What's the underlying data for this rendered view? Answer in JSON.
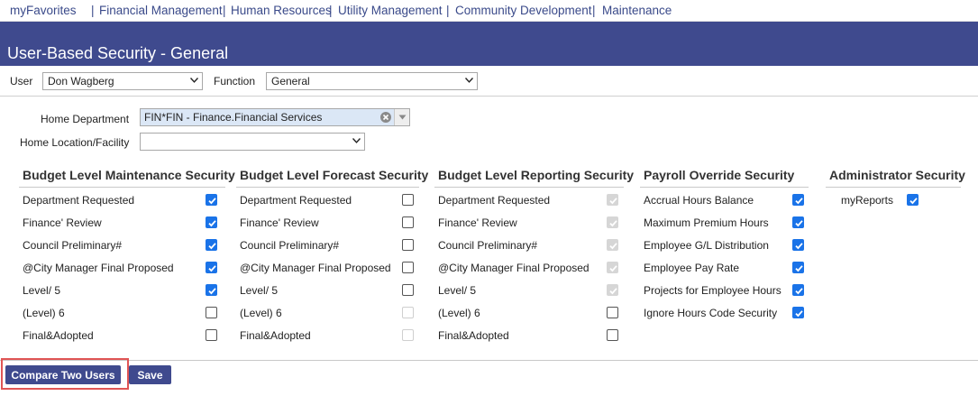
{
  "topnav": {
    "items": [
      "myFavorites",
      "Financial Management",
      "Human Resources",
      "Utility Management",
      "Community Development",
      "Maintenance"
    ]
  },
  "page": {
    "title": "User-Based Security - General"
  },
  "filters": {
    "user_label": "User",
    "user_value": "Don Wagberg",
    "function_label": "Function",
    "function_value": "General"
  },
  "home": {
    "dept_label": "Home Department",
    "dept_value": "FIN*FIN - Finance.Financial Services",
    "location_label": "Home Location/Facility",
    "location_value": ""
  },
  "sections": [
    {
      "title": "Budget Level Maintenance Security",
      "rows": [
        {
          "label": "Department Requested",
          "state": "on"
        },
        {
          "label": "Finance' Review",
          "state": "on"
        },
        {
          "label": "Council Preliminary#",
          "state": "on"
        },
        {
          "label": "@City Manager Final Proposed",
          "state": "on"
        },
        {
          "label": "Level/ 5",
          "state": "on"
        },
        {
          "label": "(Level) 6",
          "state": "off"
        },
        {
          "label": "Final&Adopted",
          "state": "off"
        }
      ]
    },
    {
      "title": "Budget Level Forecast Security",
      "rows": [
        {
          "label": "Department Requested",
          "state": "off"
        },
        {
          "label": "Finance' Review",
          "state": "off"
        },
        {
          "label": "Council Preliminary#",
          "state": "off"
        },
        {
          "label": "@City Manager Final Proposed",
          "state": "off"
        },
        {
          "label": "Level/ 5",
          "state": "off"
        },
        {
          "label": "(Level) 6",
          "state": "dis-off"
        },
        {
          "label": "Final&Adopted",
          "state": "dis-off"
        }
      ]
    },
    {
      "title": "Budget Level Reporting Security",
      "rows": [
        {
          "label": "Department Requested",
          "state": "dis-on"
        },
        {
          "label": "Finance' Review",
          "state": "dis-on"
        },
        {
          "label": "Council Preliminary#",
          "state": "dis-on"
        },
        {
          "label": "@City Manager Final Proposed",
          "state": "dis-on"
        },
        {
          "label": "Level/ 5",
          "state": "dis-on"
        },
        {
          "label": "(Level) 6",
          "state": "off"
        },
        {
          "label": "Final&Adopted",
          "state": "off"
        }
      ]
    },
    {
      "title": "Payroll Override Security",
      "rows": [
        {
          "label": "Accrual Hours Balance",
          "state": "on"
        },
        {
          "label": "Maximum Premium Hours",
          "state": "on"
        },
        {
          "label": "Employee G/L Distribution",
          "state": "on"
        },
        {
          "label": "Employee Pay Rate",
          "state": "on"
        },
        {
          "label": "Projects for Employee Hours",
          "state": "on"
        },
        {
          "label": "Ignore Hours Code Security",
          "state": "on"
        }
      ]
    },
    {
      "title": "Administrator Security",
      "rows": [
        {
          "label": "myReports",
          "state": "on"
        }
      ]
    }
  ],
  "buttons": {
    "compare": "Compare Two Users",
    "save": "Save"
  },
  "colors": {
    "brand": "#3f4a8e",
    "checkbox_checked": "#1a73e8",
    "highlight": "#e05555"
  }
}
